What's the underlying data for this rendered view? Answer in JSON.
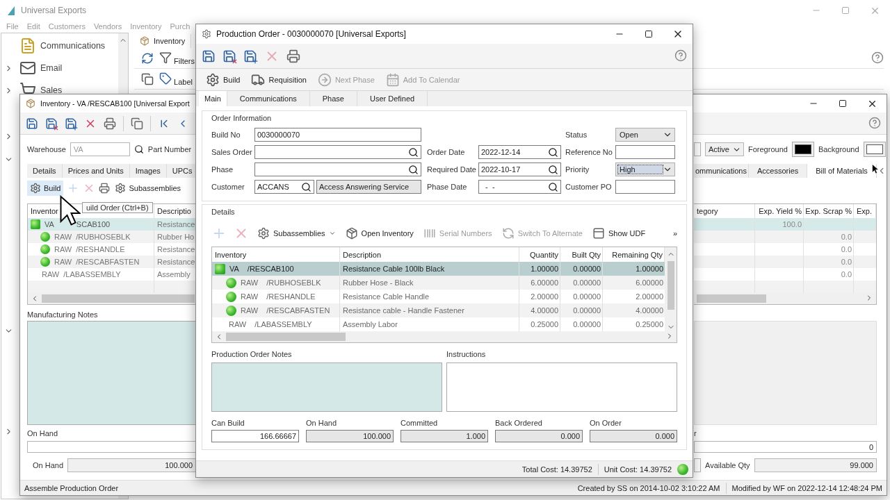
{
  "app": {
    "title": "Universal Exports",
    "menu": [
      "File",
      "Edit",
      "Customers",
      "Vendors",
      "Inventory",
      "Purch"
    ],
    "nav": [
      {
        "label": "Communications"
      },
      {
        "label": "Email",
        "expanded": false
      },
      {
        "label": "Sales",
        "expanded": false
      }
    ],
    "nav_toggles": [
      {
        "expanded": false
      },
      {
        "expanded": true
      },
      {
        "expanded": true
      },
      {
        "expanded": false
      }
    ],
    "tab": "Inventory",
    "tools": [
      "Filters",
      "Label"
    ]
  },
  "inventory": {
    "title": "Inventory - VA /RESCAB100 [Universal Export",
    "warehouse_label": "Warehouse",
    "warehouse": "VA",
    "part_label": "Part Number",
    "status": "Active",
    "foreground_label": "Foreground",
    "background_label": "Background",
    "tabs_left": [
      {
        "label": "Details",
        "selected": false
      },
      {
        "label": "Prices and Units",
        "selected": false
      },
      {
        "label": "Images",
        "selected": false
      },
      {
        "label": "UPCs",
        "selected": false
      }
    ],
    "tabs_right": [
      {
        "label": "ommunications",
        "selected": false
      },
      {
        "label": "Accessories",
        "selected": false
      },
      {
        "label": "Bill of Materials",
        "selected": true
      }
    ],
    "build": "Build",
    "subassemblies": "Subassemblies",
    "tooltip": "uild Order (Ctrl+B)",
    "columns_left": [
      "Inventor",
      "Descriptio"
    ],
    "columns_right": [
      "tegory",
      "Exp. Yield %",
      "Exp. Scrap %",
      "Exp."
    ],
    "rows": [
      {
        "kind": "square",
        "warehouse": "VA",
        "part": "SCAB100",
        "description": "Resistance",
        "yield": "100.0",
        "selected": true,
        "children": [
          {
            "kind": "dot",
            "warehouse": "RAW",
            "part": "/RUBHOSEBLK",
            "description": "Rubber Ho",
            "scrap": "0.0",
            "selected": false
          },
          {
            "kind": "dot",
            "warehouse": "RAW",
            "part": "/RESHANDLE",
            "description": "Resistance",
            "scrap": "0.0",
            "selected": false
          },
          {
            "kind": "dot",
            "warehouse": "RAW",
            "part": "/RESCABFASTEN",
            "description": "Resistance",
            "scrap": "0.0",
            "selected": false
          },
          {
            "kind": "plain",
            "warehouse": "RAW",
            "part": "/LABASSEMBLY",
            "description": "Assembly",
            "scrap": "0.0",
            "selected": false
          }
        ]
      }
    ],
    "notes_label": "Manufacturing Notes",
    "on_hand_label": "On Hand",
    "order_label": "r",
    "order_value": "0",
    "on_hand_total_label": "On Hand",
    "on_hand_total": "100.000",
    "available_label": "Available Qty",
    "available": "99.000",
    "status_text": "Assemble Production Order",
    "created": "Created by SS on 2014-10-02 3:10:22 AM",
    "modified": "Modified by WF on 2022-12-14 12:48:24 PM"
  },
  "production": {
    "title": "Production Order - 0030000070 [Universal Exports]",
    "actions": [
      {
        "label": "Build",
        "disabled": false
      },
      {
        "label": "Requisition",
        "disabled": false
      },
      {
        "label": "Next Phase",
        "disabled": true
      },
      {
        "label": "Add To Calendar",
        "disabled": true
      }
    ],
    "tabs": [
      {
        "label": "Main",
        "selected": true
      },
      {
        "label": "Communications",
        "selected": false
      },
      {
        "label": "Phase",
        "selected": false
      },
      {
        "label": "User Defined",
        "selected": false
      }
    ],
    "order_title": "Order Information",
    "form_rows": [
      [
        {
          "label": "Build No",
          "kind": "text",
          "value": "0030000070"
        },
        {
          "label": "Status",
          "kind": "select",
          "value": "Open",
          "focused": false
        }
      ],
      [
        {
          "label": "Sales Order",
          "kind": "lookup"
        },
        {
          "label": "Order Date",
          "kind": "lookup",
          "value": "2022-12-14"
        },
        {
          "label": "Reference No",
          "kind": "text"
        }
      ],
      [
        {
          "label": "Phase",
          "kind": "lookup"
        },
        {
          "label": "Required Date",
          "kind": "lookup",
          "value": "2022-10-17"
        },
        {
          "label": "Priority",
          "kind": "select",
          "value": "High",
          "focused": true
        }
      ],
      [
        {
          "label": "Customer",
          "kind": "customer",
          "value": "ACCANS",
          "name": "Access Answering Service"
        },
        {
          "label": "Phase Date",
          "kind": "lookup",
          "value": "  -  -"
        },
        {
          "label": "Customer PO",
          "kind": "text"
        }
      ]
    ],
    "details_title": "Details",
    "detail_tools": [
      {
        "kind": "add",
        "disabled": true
      },
      {
        "kind": "delete",
        "disabled": true
      },
      {
        "kind": "menu",
        "label": "Subassemblies",
        "disabled": false
      },
      {
        "kind": "button",
        "label": "Open Inventory",
        "disabled": false
      },
      {
        "kind": "button",
        "label": "Serial Numbers",
        "disabled": true
      },
      {
        "kind": "button",
        "label": "Switch To Alternate",
        "disabled": true
      },
      {
        "kind": "button",
        "label": "Show UDF",
        "disabled": false
      }
    ],
    "overflow": "»",
    "columns": [
      "Inventory",
      "Description",
      "Quantity",
      "Built Qty",
      "Remaining Qty"
    ],
    "rows": [
      {
        "kind": "square",
        "warehouse": "VA",
        "part": "/RESCAB100",
        "description": "Resistance Cable 100lb Black",
        "quantity": "1.00000",
        "built": "0.00000",
        "remaining": "1.00000",
        "selected": true,
        "children": [
          {
            "kind": "dot",
            "warehouse": "RAW",
            "part": "/RUBHOSEBLK",
            "description": "Rubber Hose - Black",
            "quantity": "6.00000",
            "built": "0.00000",
            "remaining": "6.00000",
            "selected": false
          },
          {
            "kind": "dot",
            "warehouse": "RAW",
            "part": "/RESHANDLE",
            "description": "Resistance Cable Handle",
            "quantity": "2.00000",
            "built": "0.00000",
            "remaining": "2.00000",
            "selected": false
          },
          {
            "kind": "dot",
            "warehouse": "RAW",
            "part": "/RESCABFASTEN",
            "description": "Resistance cable - Handle Fastener",
            "quantity": "4.00000",
            "built": "0.00000",
            "remaining": "4.00000",
            "selected": false
          },
          {
            "kind": "plain",
            "warehouse": "RAW",
            "part": "/LABASSEMBLY",
            "description": "Assembly Labor",
            "quantity": "0.25000",
            "built": "0.00000",
            "remaining": "0.25000",
            "selected": false
          }
        ]
      }
    ],
    "notes_label": "Production Order Notes",
    "instructions_label": "Instructions",
    "totals": [
      {
        "label": "Can Build",
        "value": "166.66667",
        "readonly": false
      },
      {
        "label": "On Hand",
        "value": "100.000",
        "readonly": true
      },
      {
        "label": "Committed",
        "value": "1.000",
        "readonly": true
      },
      {
        "label": "Back Ordered",
        "value": "0.000",
        "readonly": true
      },
      {
        "label": "On Order",
        "value": "0.000",
        "readonly": true
      }
    ],
    "total_cost": "Total Cost: 14.39752",
    "unit_cost": "Unit Cost: 14.39752",
    "cost_ok": true
  }
}
